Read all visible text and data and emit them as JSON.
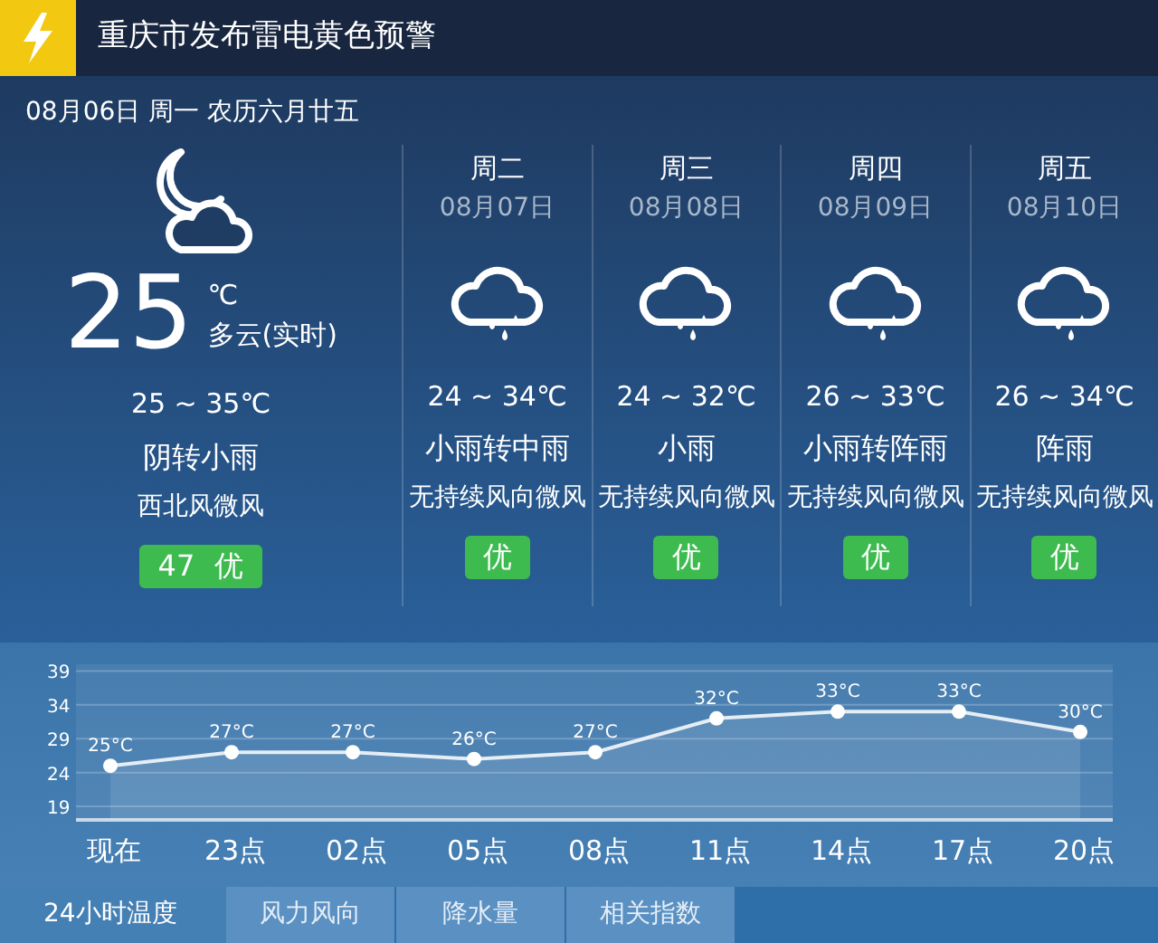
{
  "alert": {
    "title": "重庆市发布雷电黄色预警"
  },
  "date_line": "08月06日 周一 农历六月廿五",
  "current": {
    "temperature": "25",
    "unit": "℃",
    "condition": "多云(实时)",
    "range": "25 ~ 35℃",
    "forecast": "阴转小雨",
    "wind": "西北风微风",
    "aqi": "47 优"
  },
  "days": [
    {
      "weekday": "周二",
      "date": "08月07日",
      "range": "24 ~ 34℃",
      "forecast": "小雨转中雨",
      "wind": "无持续风向微风",
      "aqi": "优"
    },
    {
      "weekday": "周三",
      "date": "08月08日",
      "range": "24 ~ 32℃",
      "forecast": "小雨",
      "wind": "无持续风向微风",
      "aqi": "优"
    },
    {
      "weekday": "周四",
      "date": "08月09日",
      "range": "26 ~ 33℃",
      "forecast": "小雨转阵雨",
      "wind": "无持续风向微风",
      "aqi": "优"
    },
    {
      "weekday": "周五",
      "date": "08月10日",
      "range": "26 ~ 34℃",
      "forecast": "阵雨",
      "wind": "无持续风向微风",
      "aqi": "优"
    }
  ],
  "chart_data": {
    "type": "area",
    "ylim": [
      17,
      40
    ],
    "grid": true,
    "marker": true,
    "categories": [
      "现在",
      "23点",
      "02点",
      "05点",
      "08点",
      "11点",
      "14点",
      "17点",
      "20点"
    ],
    "values": [
      25,
      27,
      27,
      26,
      27,
      32,
      33,
      33,
      30
    ],
    "value_labels": [
      "25°C",
      "27°C",
      "27°C",
      "26°C",
      "27°C",
      "32°C",
      "33°C",
      "33°C",
      "30°C"
    ],
    "yticks": [
      19,
      24,
      29,
      34,
      39
    ]
  },
  "tabs": [
    {
      "label": "24小时温度",
      "selected": true
    },
    {
      "label": "风力风向",
      "selected": false
    },
    {
      "label": "降水量",
      "selected": false
    },
    {
      "label": "相关指数",
      "selected": false
    }
  ]
}
